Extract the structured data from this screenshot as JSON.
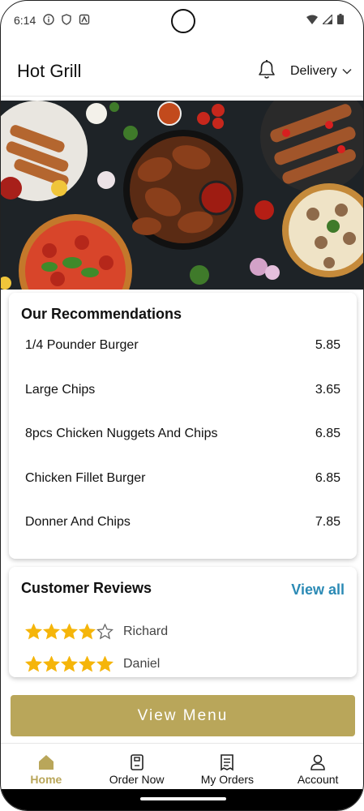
{
  "status_bar": {
    "time": "6:14"
  },
  "header": {
    "title": "Hot Grill",
    "delivery_label": "Delivery"
  },
  "recommendations": {
    "title": "Our Recommendations",
    "items": [
      {
        "name": "1/4 Pounder Burger",
        "price": "5.85"
      },
      {
        "name": "Large Chips",
        "price": "3.65"
      },
      {
        "name": "8pcs Chicken Nuggets And Chips",
        "price": "6.85"
      },
      {
        "name": "Chicken Fillet Burger",
        "price": "6.85"
      },
      {
        "name": "Donner And Chips",
        "price": "7.85"
      }
    ]
  },
  "reviews": {
    "title": "Customer Reviews",
    "view_all": "View all",
    "items": [
      {
        "name": "Richard",
        "rating": 4
      },
      {
        "name": "Daniel",
        "rating": 5
      }
    ]
  },
  "view_menu_label": "View Menu",
  "nav": {
    "items": [
      {
        "label": "Home",
        "icon": "home-icon",
        "active": true
      },
      {
        "label": "Order Now",
        "icon": "order-icon",
        "active": false
      },
      {
        "label": "My Orders",
        "icon": "receipt-icon",
        "active": false
      },
      {
        "label": "Account",
        "icon": "account-icon",
        "active": false
      }
    ]
  },
  "colors": {
    "accent": "#b9a65a",
    "link": "#2b8ab5",
    "star": "#f5b50a"
  }
}
